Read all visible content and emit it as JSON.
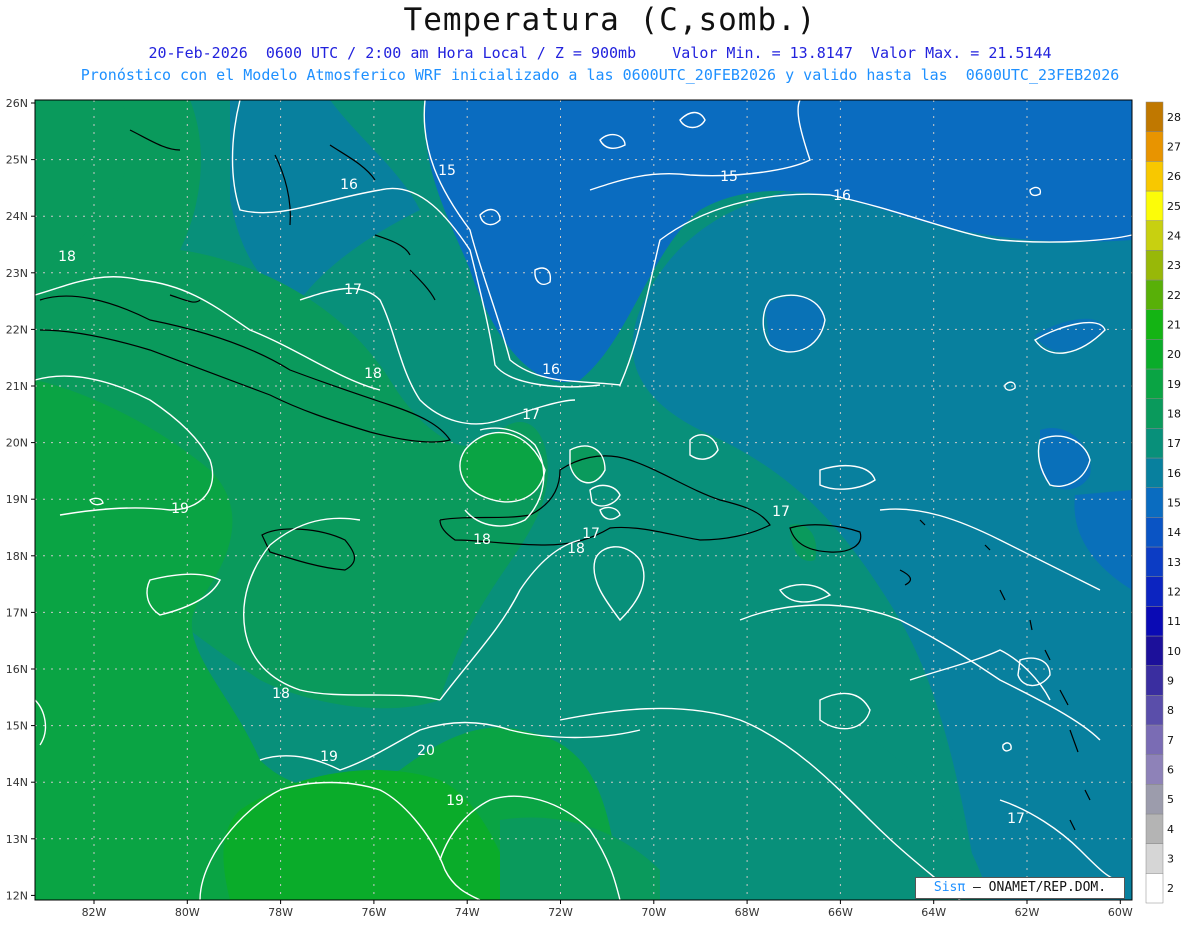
{
  "header": {
    "title": "Temperatura (C,somb.)",
    "line1": "20-Feb-2026  0600 UTC / 2:00 am Hora Local / Z = 900mb    Valor Min. = 13.8147  Valor Max. = 21.5144",
    "line2": "Pronóstico con el Modelo Atmosferico WRF inicializado a las 0600UTC_20FEB2026 y valido hasta las  0600UTC_23FEB2026"
  },
  "axes": {
    "lat_labels": [
      "26N",
      "25N",
      "24N",
      "23N",
      "22N",
      "21N",
      "20N",
      "19N",
      "18N",
      "17N",
      "16N",
      "15N",
      "14N",
      "13N",
      "12N"
    ],
    "lon_labels": [
      "82W",
      "80W",
      "78W",
      "76W",
      "74W",
      "72W",
      "70W",
      "68W",
      "66W",
      "64W",
      "62W",
      "60W"
    ]
  },
  "colorbar": {
    "labels": [
      "2",
      "3",
      "4",
      "5",
      "6",
      "7",
      "8",
      "9",
      "10",
      "11",
      "12",
      "13",
      "14",
      "15",
      "16",
      "17",
      "18",
      "19",
      "20",
      "21",
      "22",
      "23",
      "24",
      "25",
      "26",
      "27",
      "28"
    ],
    "colors": [
      "#ffffff",
      "#d6d6d6",
      "#b4b4b4",
      "#9c9cac",
      "#8e82b8",
      "#7a6cb4",
      "#5a4eaa",
      "#3a2ea0",
      "#1c109a",
      "#0a0ab4",
      "#0c24c0",
      "#0c3cc4",
      "#0a54c4",
      "#0a6cc0",
      "#08809e",
      "#08907a",
      "#0a9a5c",
      "#0aa444",
      "#0aac2a",
      "#14b414",
      "#58b008",
      "#98b808",
      "#c8d010",
      "#fcfc08",
      "#f8c800",
      "#e89400",
      "#c07800"
    ]
  },
  "contour_labels": [
    "15",
    "15",
    "16",
    "16",
    "17",
    "16",
    "17",
    "18",
    "18",
    "19",
    "18",
    "18",
    "17",
    "17",
    "18",
    "19",
    "20",
    "19",
    "17"
  ],
  "credit": {
    "sis": "Sisπ",
    "rest": " – ONAMET/REP.DOM."
  }
}
